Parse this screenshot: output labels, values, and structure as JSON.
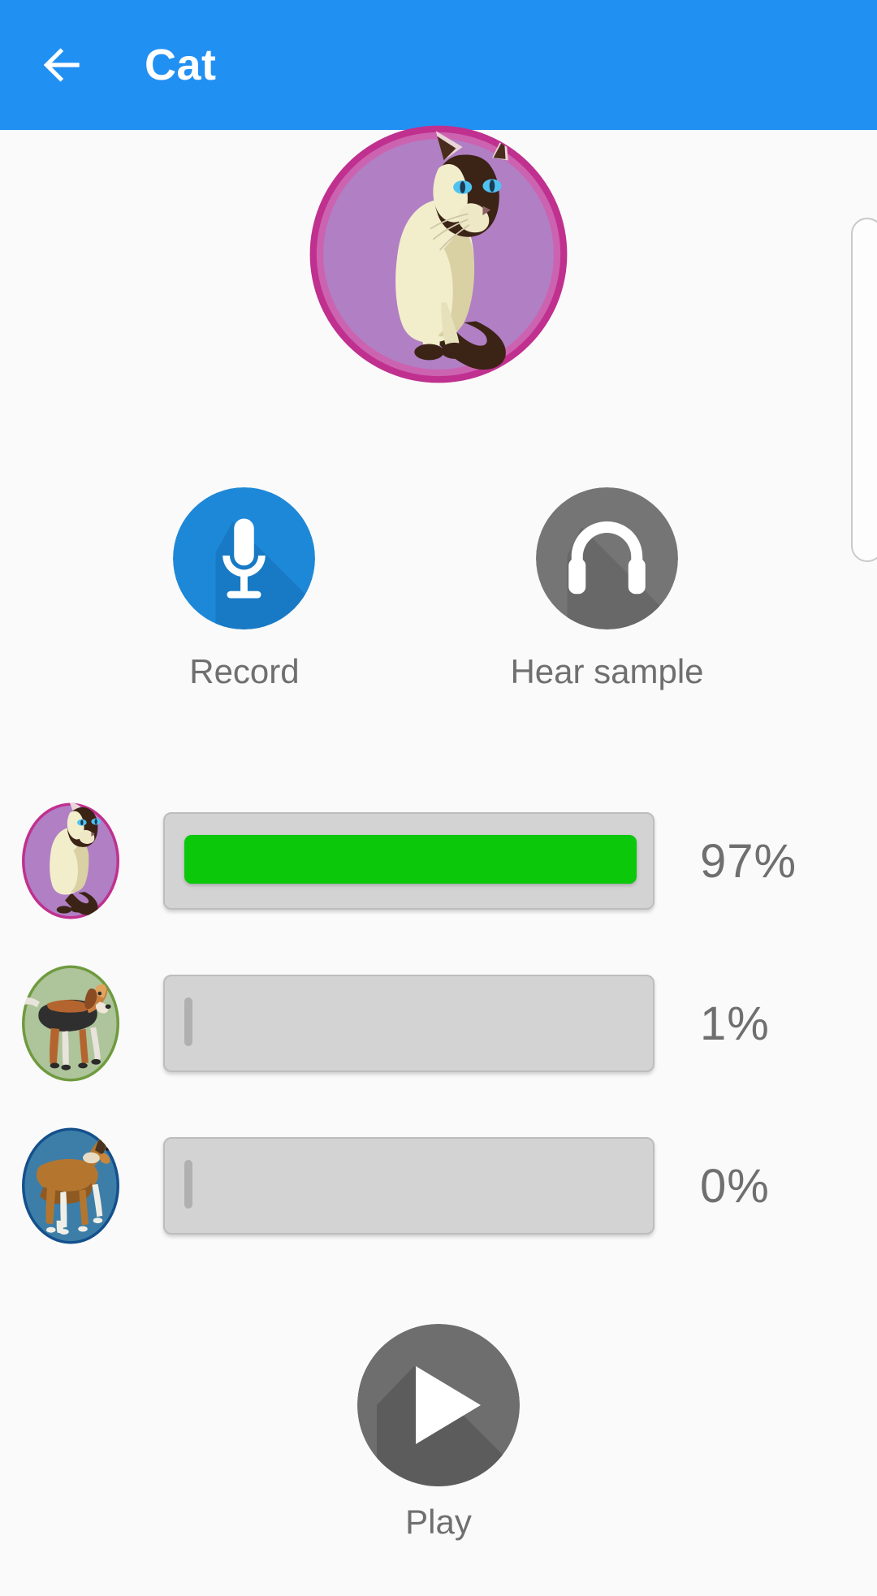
{
  "app": {
    "background_color": "#fafafa"
  },
  "appbar": {
    "title": "Cat",
    "back_icon": "arrow-left-icon",
    "background_color": "#2190f3",
    "text_color": "#ffffff"
  },
  "hero": {
    "animal": "cat",
    "icon": "cat-avatar-icon",
    "circle_fill": "#b07fc4",
    "circle_border": "#c0308f"
  },
  "actions": [
    {
      "label": "Record",
      "icon": "microphone-icon",
      "circle_color": "#1e88d8",
      "icon_color": "#ffffff"
    },
    {
      "label": "Hear sample",
      "icon": "headphones-icon",
      "circle_color": "#757575",
      "icon_color": "#ffffff"
    }
  ],
  "results": {
    "rows": [
      {
        "animal": "cat",
        "avatar_icon": "cat-avatar-icon",
        "avatar_fill": "#b07fc4",
        "avatar_border": "#c0308f",
        "percent_label": "97%",
        "percent_value": 97,
        "fill_color": "#0bc80b"
      },
      {
        "animal": "dog",
        "avatar_icon": "dog-avatar-icon",
        "avatar_fill": "#aec49a",
        "avatar_border": "#6f9a3f",
        "percent_label": "1%",
        "percent_value": 1,
        "fill_color": "#b0b0b0"
      },
      {
        "animal": "goat",
        "avatar_icon": "goat-avatar-icon",
        "avatar_fill": "#3d7ea8",
        "avatar_border": "#14508c",
        "percent_label": "0%",
        "percent_value": 0,
        "fill_color": "#b0b0b0"
      }
    ],
    "track_color": "#d3d3d3",
    "text_color": "#6f6f6f"
  },
  "play": {
    "label": "Play",
    "icon": "play-triangle-icon",
    "circle_color": "#757575",
    "icon_color": "#ffffff"
  },
  "scrollbar": {
    "visible": true
  }
}
